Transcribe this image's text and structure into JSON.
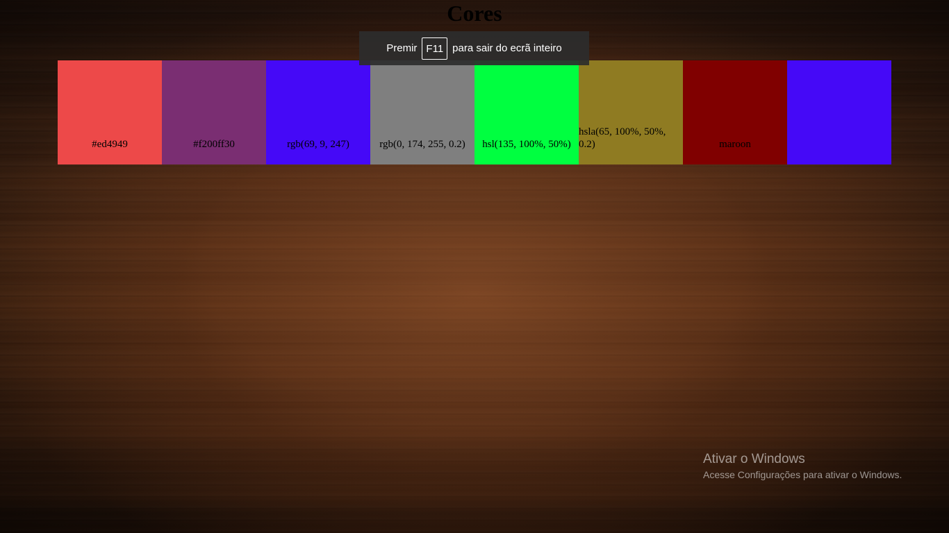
{
  "page": {
    "title": "Cores"
  },
  "swatches": [
    {
      "label": "#ed4949",
      "color": "#ed4949"
    },
    {
      "label": "#f200ff30",
      "color": "#f200ff30"
    },
    {
      "label": "rgb(69, 9, 247)",
      "color": "rgb(69, 9, 247)"
    },
    {
      "label": "rgb(0, 174, 255, 0.2)",
      "color": "rgb(0, 174, 255, 0.2)"
    },
    {
      "label": "hsl(135, 100%, 50%)",
      "color": "hsl(135, 100%, 50%)"
    },
    {
      "label": "hsla(65, 100%, 50%, 0.2)",
      "color": "hsla(65, 100%, 50%, 0.2)"
    },
    {
      "label": "maroon",
      "color": "maroon"
    },
    {
      "label": "",
      "color": "rgb(69, 9, 247)"
    }
  ],
  "fullscreen_toast": {
    "before": "Premir",
    "key": "F11",
    "after": "para sair do ecrã inteiro"
  },
  "watermark": {
    "title": "Ativar o Windows",
    "subtitle": "Acesse Configurações para ativar o Windows."
  }
}
